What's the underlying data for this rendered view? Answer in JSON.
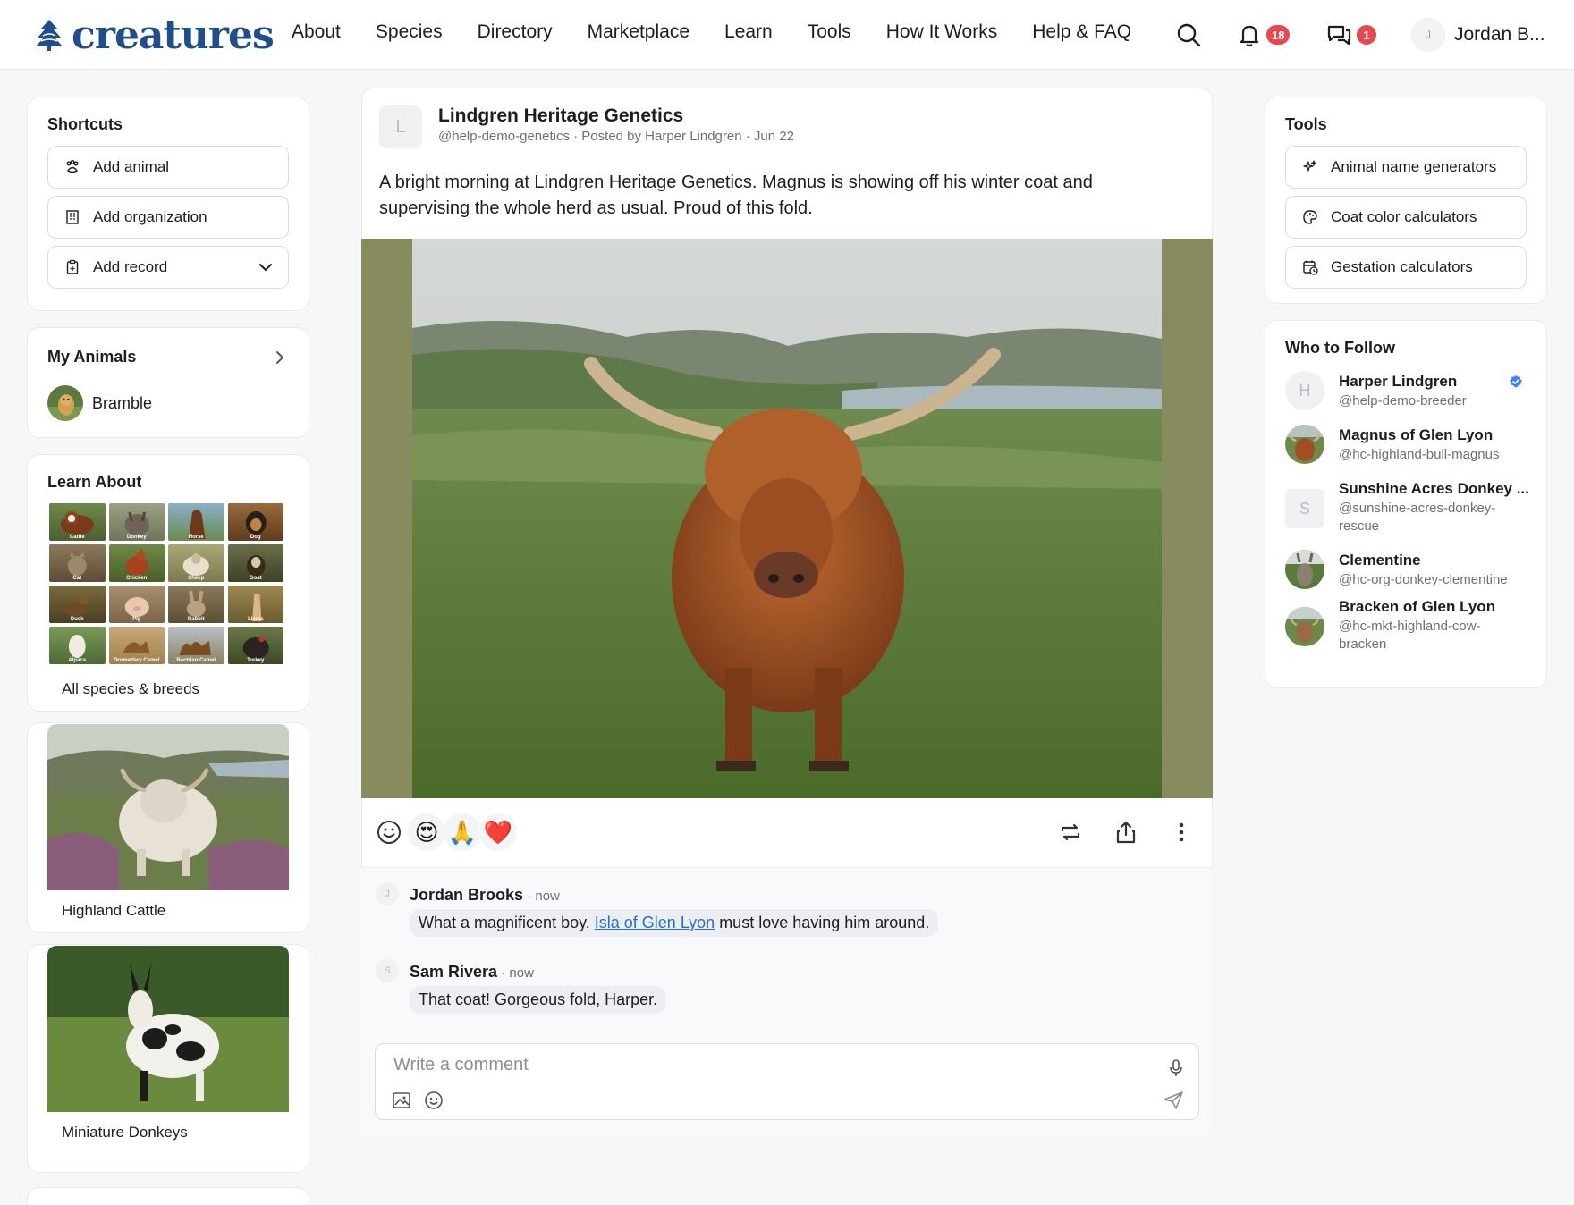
{
  "brand": {
    "name": "creatures",
    "color": "#1f4e8c"
  },
  "nav": [
    "About",
    "Species",
    "Directory",
    "Marketplace",
    "Learn",
    "Tools",
    "How It Works",
    "Help & FAQ"
  ],
  "header": {
    "notifications": "18",
    "messages": "1",
    "user_initial": "J",
    "user_name": "Jordan B..."
  },
  "shortcuts": {
    "title": "Shortcuts",
    "add_animal": "Add animal",
    "add_org": "Add organization",
    "add_record": "Add record"
  },
  "my_animals": {
    "title": "My Animals",
    "items": [
      "Bramble"
    ]
  },
  "learn": {
    "title": "Learn About",
    "species": [
      "Cattle",
      "Donkey",
      "Horse",
      "Dog",
      "Cat",
      "Chicken",
      "Sheep",
      "Goat",
      "Duck",
      "Pig",
      "Rabbit",
      "Llama",
      "Alpaca",
      "Dromedary Camel",
      "Bactrian Camel",
      "Turkey"
    ],
    "all_label": "All species & breeds",
    "features": [
      "Highland Cattle",
      "Miniature Donkeys"
    ]
  },
  "post": {
    "avatar_initial": "L",
    "title": "Lindgren Heritage Genetics",
    "subtitle": "@help-demo-genetics · Posted by Harper Lindgren · Jun 22",
    "body": "A bright morning at Lindgren Heritage Genetics. Magnus is showing off his winter coat and supervising the whole herd as usual. Proud of this fold.",
    "reactions": [
      "😍",
      "🙏",
      "❤️"
    ]
  },
  "comments": [
    {
      "initial": "J",
      "name": "Jordan Brooks",
      "time": " · now",
      "text_before": "What a magnificent boy. ",
      "mention": "Isla of Glen Lyon",
      "text_after": " must love having him around."
    },
    {
      "initial": "S",
      "name": "Sam Rivera",
      "time": " · now",
      "text_before": "That coat! Gorgeous fold, Harper.",
      "mention": "",
      "text_after": ""
    }
  ],
  "comment_box": {
    "placeholder": "Write a comment"
  },
  "tools": {
    "title": "Tools",
    "items": [
      "Animal name generators",
      "Coat color calculators",
      "Gestation calculators"
    ]
  },
  "who_to_follow": {
    "title": "Who to Follow",
    "people": [
      {
        "initial": "H",
        "name": "Harper Lindgren",
        "handle": "@help-demo-breeder"
      },
      {
        "initial": "",
        "name": "Magnus of Glen Lyon",
        "handle": "@hc-highland-bull-magnus"
      },
      {
        "initial": "S",
        "name": "Sunshine Acres Donkey ...",
        "handle": "@sunshine-acres-donkey-rescue"
      },
      {
        "initial": "",
        "name": "Clementine",
        "handle": "@hc-org-donkey-clementine"
      },
      {
        "initial": "",
        "name": "Bracken of Glen Lyon",
        "handle": "@hc-mkt-highland-cow-bracken"
      }
    ]
  },
  "colors": {
    "accent": "#1f4e8c",
    "badge": "#e5484d",
    "link": "#1f6fd1",
    "verified": "#3b82f6"
  }
}
